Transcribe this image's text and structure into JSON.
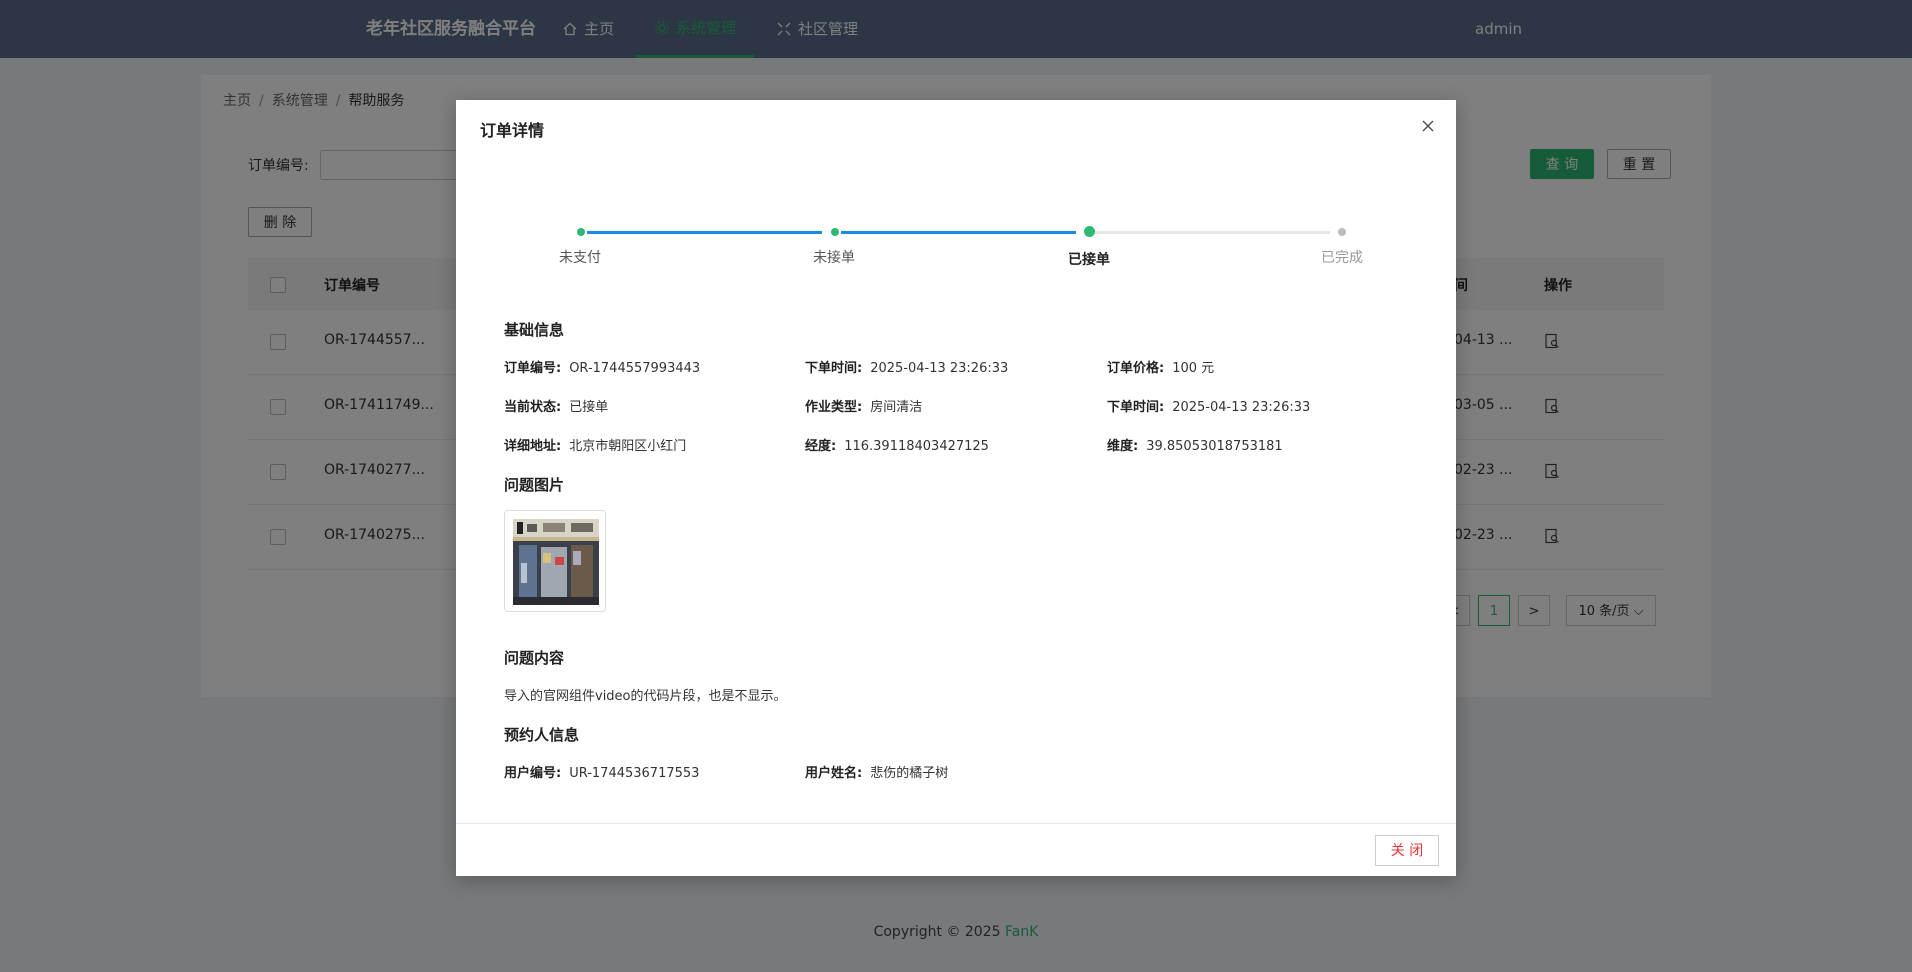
{
  "app": {
    "brand": "老年社区服务融合平台",
    "nav": [
      {
        "label": "主页",
        "icon": "home-icon"
      },
      {
        "label": "系统管理",
        "icon": "settings-icon"
      },
      {
        "label": "社区管理",
        "icon": "expand-icon"
      }
    ],
    "user": "admin"
  },
  "breadcrumb": [
    "主页",
    "系统管理",
    "帮助服务"
  ],
  "filter": {
    "label": "订单编号:",
    "value": ""
  },
  "buttons": {
    "search": "查 询",
    "reset": "重 置",
    "delete": "删 除"
  },
  "table": {
    "headers": {
      "order_no": "订单编号",
      "time": "间",
      "actions": "操作"
    },
    "rows": [
      {
        "order_no": "OR-1744557...",
        "time": "04-13 ..."
      },
      {
        "order_no": "OR-17411749...",
        "time": "03-05 ..."
      },
      {
        "order_no": "OR-1740277...",
        "time": "02-23 ..."
      },
      {
        "order_no": "OR-1740275...",
        "time": "02-23 ..."
      }
    ]
  },
  "pagination": {
    "current": "1",
    "page_size": "10 条/页"
  },
  "footer": {
    "text": "Copyright © 2025 ",
    "brand": "FanK"
  },
  "modal": {
    "title": "订单详情",
    "steps": [
      {
        "label": "未支付",
        "state": "done"
      },
      {
        "label": "未接单",
        "state": "done"
      },
      {
        "label": "已接单",
        "state": "current"
      },
      {
        "label": "已完成",
        "state": "todo"
      }
    ],
    "sections": {
      "basic": "基础信息",
      "images": "问题图片",
      "content": "问题内容",
      "booker": "预约人信息"
    },
    "basic": {
      "order_no": {
        "label": "订单编号:",
        "value": "OR-1744557993443"
      },
      "order_time": {
        "label": "下单时间:",
        "value": "2025-04-13 23:26:33"
      },
      "price": {
        "label": "订单价格:",
        "value": "100 元"
      },
      "status": {
        "label": "当前状态:",
        "value": "已接单"
      },
      "job_type": {
        "label": "作业类型:",
        "value": "房间清洁"
      },
      "order_time2": {
        "label": "下单时间:",
        "value": "2025-04-13 23:26:33"
      },
      "address": {
        "label": "详细地址:",
        "value": "北京市朝阳区小红门"
      },
      "longitude": {
        "label": "经度:",
        "value": "116.39118403427125"
      },
      "latitude": {
        "label": "维度:",
        "value": "39.85053018753181"
      }
    },
    "content_text": "导入的官网组件video的代码片段，也是不显示。",
    "booker": {
      "user_no": {
        "label": "用户编号:",
        "value": "UR-1744536717553"
      },
      "user_name": {
        "label": "用户姓名:",
        "value": "悲伤的橘子树"
      }
    },
    "close_label": "关 闭",
    "colors": {
      "accent": "#2eb872",
      "progress": "#1e88e5",
      "danger": "#e33333"
    }
  }
}
